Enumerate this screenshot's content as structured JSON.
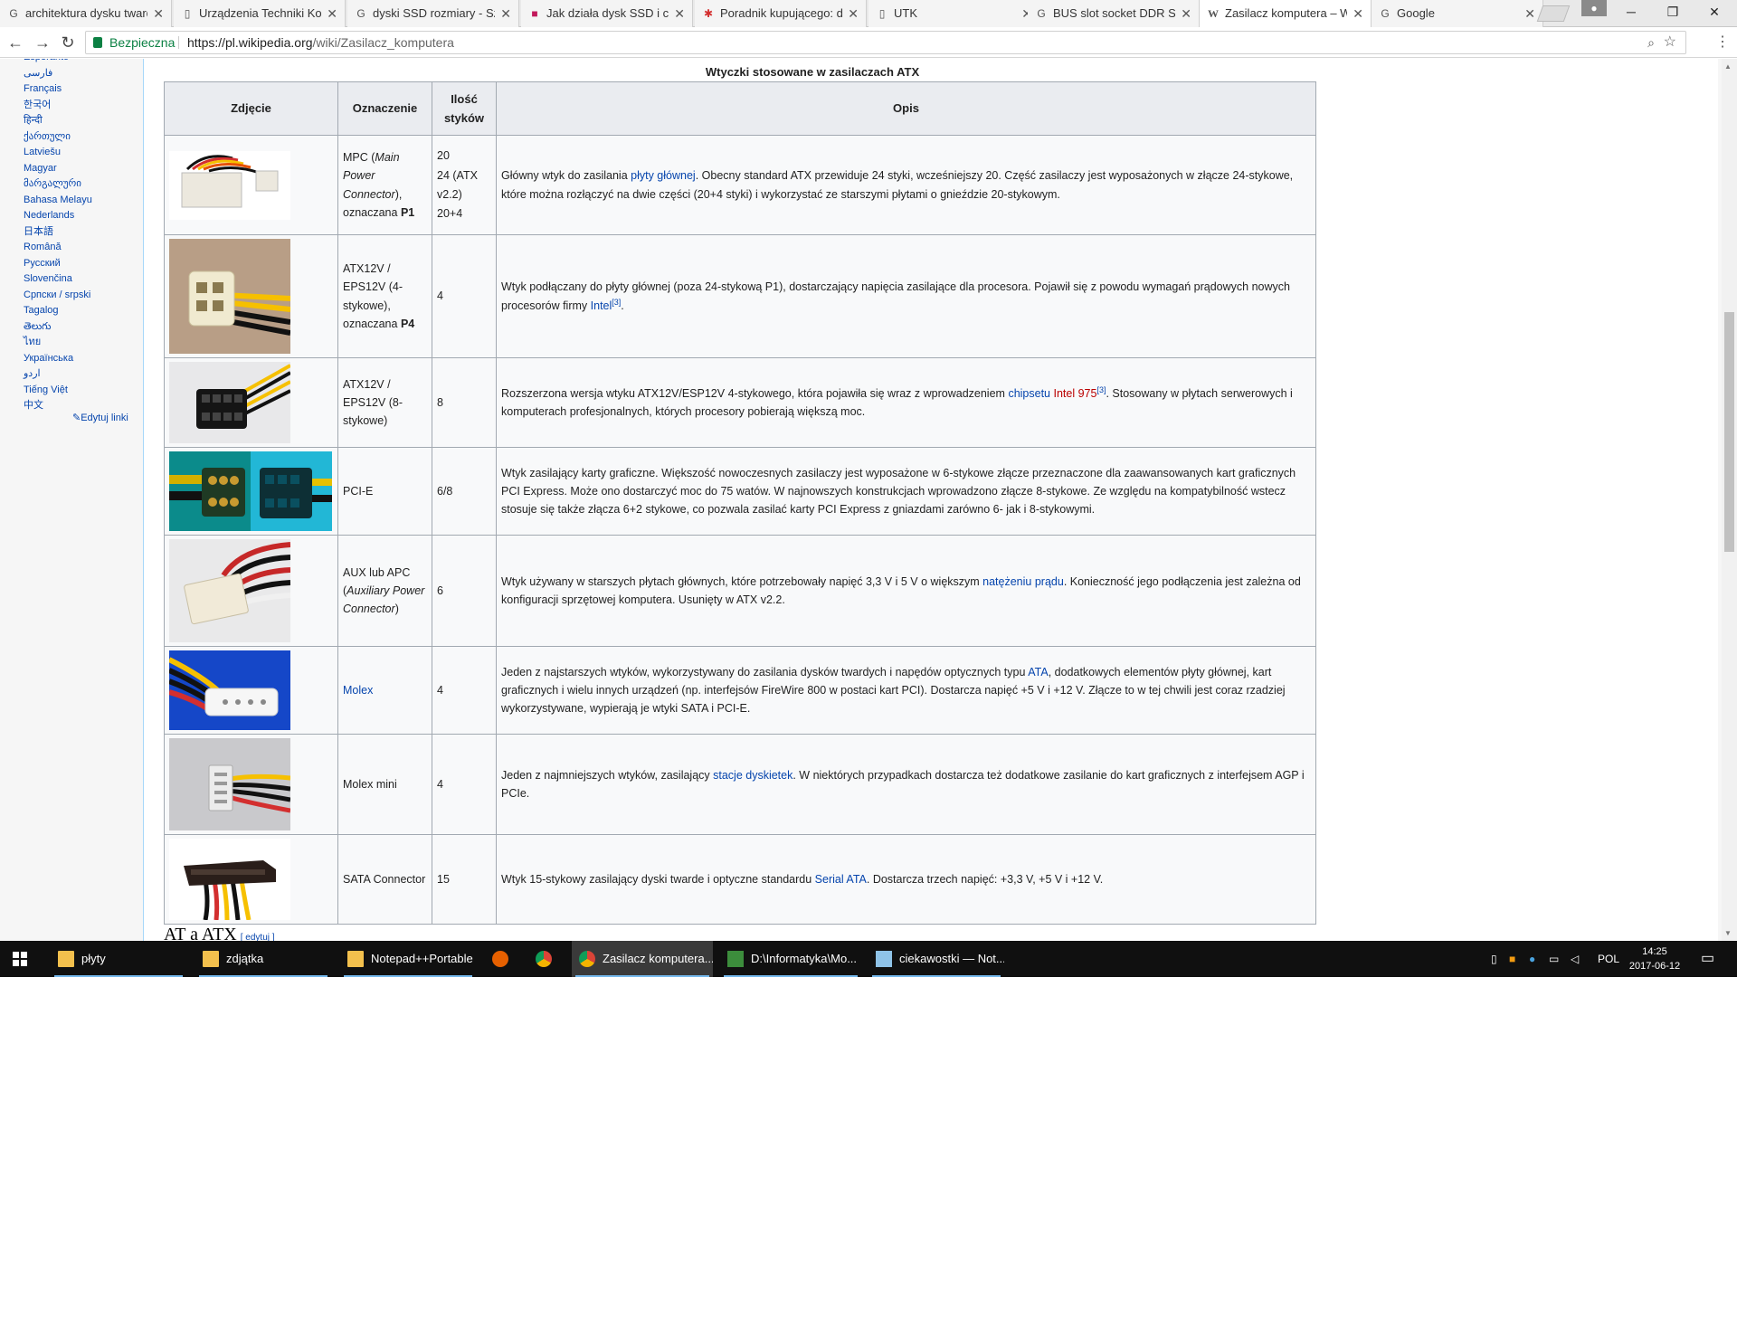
{
  "browser": {
    "tabs": [
      {
        "title": "architektura dysku tward",
        "icon": "google-icon"
      },
      {
        "title": "Urządzenia Techniki Kom",
        "icon": "page-icon"
      },
      {
        "title": "dyski SSD rozmiary - Szu",
        "icon": "google-icon"
      },
      {
        "title": "Jak działa dysk SSD i czy",
        "icon": "bookmark-icon"
      },
      {
        "title": "Poradnik kupującego: di",
        "icon": "site-icon"
      },
      {
        "title": "UTK",
        "icon": "page-icon"
      },
      {
        "title": "BUS slot socket DDR SD",
        "icon": "google-icon"
      },
      {
        "title": "Zasilacz komputera – Wi",
        "icon": "wikipedia-icon"
      },
      {
        "title": "Google",
        "icon": "google-icon"
      }
    ],
    "security_label": "Bezpieczna",
    "url_domain": "https://pl.wikipedia.org",
    "url_path": "/wiki/Zasilacz_komputera"
  },
  "sidebar": {
    "languages": [
      "Esperanto",
      "فارسی",
      "Français",
      "한국어",
      "हिन्दी",
      "ქართული",
      "Latviešu",
      "Magyar",
      "მარგალური",
      "Bahasa Melayu",
      "Nederlands",
      "日本語",
      "Română",
      "Русский",
      "Slovenčina",
      "Српски / srpski",
      "Tagalog",
      "తెలుగు",
      "ไทย",
      "Українська",
      "اردو",
      "Tiếng Việt",
      "中文"
    ],
    "edit_links": "Edytuj linki"
  },
  "table": {
    "caption": "Wtyczki stosowane w zasilaczach ATX",
    "headers": {
      "photo": "Zdjęcie",
      "name": "Oznaczenie",
      "count": "Ilość styków",
      "desc": "Opis"
    },
    "rows": [
      {
        "name_pre": "MPC (",
        "name_em": "Main Power Connector",
        "name_post": "), oznaczana ",
        "name_bold": "P1",
        "count_lines": [
          "20",
          "24 (ATX v2.2)",
          "20+4"
        ],
        "desc_a": "Główny wtyk do zasilania ",
        "desc_link": "płyty głównej",
        "desc_b": ". Obecny standard ATX przewiduje 24 styki, wcześniejszy 20. Część zasilaczy jest wyposażonych w złącze 24-stykowe, które można rozłączyć na dwie części (20+4 styki) i wykorzystać ze starszymi płytami o gnieździe 20-stykowym."
      },
      {
        "name_pre": "ATX12V / EPS12V (4-stykowe), oznaczana ",
        "name_bold": "P4",
        "count": "4",
        "desc_a": "Wtyk podłączany do płyty głównej (poza 24-stykową P1), dostarczający napięcia zasilające dla procesora. Pojawił się z powodu wymagań prądowych nowych procesorów firmy ",
        "desc_link": "Intel",
        "desc_ref": "[3]",
        "desc_b": "."
      },
      {
        "name_pre": "ATX12V / EPS12V (8-stykowe)",
        "count": "8",
        "desc_a": "Rozszerzona wersja wtyku ATX12V/ESP12V 4-stykowego, która pojawiła się wraz z wprowadzeniem ",
        "desc_link": "chipsetu",
        "desc_link2": "Intel 975",
        "desc_ref": "[3]",
        "desc_b": ". Stosowany w płytach serwerowych i komputerach profesjonalnych, których procesory pobierają większą moc."
      },
      {
        "name_pre": "PCI-E",
        "count": "6/8",
        "desc_a": "Wtyk zasilający karty graficzne. Większość nowoczesnych zasilaczy jest wyposażone w 6-stykowe złącze przeznaczone dla zaawansowanych kart graficznych PCI Express. Może ono dostarczyć moc do 75 watów. W najnowszych konstrukcjach wprowadzono złącze 8-stykowe. Ze względu na kompatybilność wstecz stosuje się także złącza 6+2 stykowe, co pozwala zasilać karty PCI Express z gniazdami zarówno 6- jak i 8-stykowymi."
      },
      {
        "name_pre": "AUX lub APC (",
        "name_em": "Auxiliary Power Connector",
        "name_post": ")",
        "count": "6",
        "desc_a": "Wtyk używany w starszych płytach głównych, które potrzebowały napięć 3,3 V i 5 V o większym ",
        "desc_link": "natężeniu prądu",
        "desc_b": ". Konieczność jego podłączenia jest zależna od konfiguracji sprzętowej komputera. Usunięty w ATX v2.2."
      },
      {
        "name_link": "Molex",
        "count": "4",
        "desc_a": "Jeden z najstarszych wtyków, wykorzystywany do zasilania dysków twardych i napędów optycznych typu ",
        "desc_link": "ATA",
        "desc_b": ", dodatkowych elementów płyty głównej, kart graficznych i wielu innych urządzeń (np. interfejsów FireWire 800 w postaci kart PCI). Dostarcza napięć +5 V i +12 V. Złącze to w tej chwili jest coraz rzadziej wykorzystywane, wypierają je wtyki SATA i PCI-E."
      },
      {
        "name_pre": "Molex mini",
        "count": "4",
        "desc_a": "Jeden z najmniejszych wtyków, zasilający ",
        "desc_link": "stacje dyskietek",
        "desc_b": ". W niektórych przypadkach dostarcza też dodatkowe zasilanie do kart graficznych z interfejsem AGP i PCIe."
      },
      {
        "name_pre": "SATA Connector",
        "count": "15",
        "desc_a": "Wtyk 15-stykowy zasilający dyski twarde i optyczne standardu ",
        "desc_link": "Serial ATA",
        "desc_b": ". Dostarcza trzech napięć: +3,3 V, +5 V i +12 V."
      }
    ]
  },
  "section": {
    "heading": "AT a ATX",
    "edit": "[ edytuj ]"
  },
  "taskbar": {
    "items": [
      "płyty",
      "zdjątka",
      "Notepad++Portable",
      "Zasilacz komputera...",
      "D:\\Informatyka\\Mo...",
      "ciekawostki — Not..."
    ],
    "language": "POL",
    "time": "14:25",
    "date": "2017-06-12"
  }
}
